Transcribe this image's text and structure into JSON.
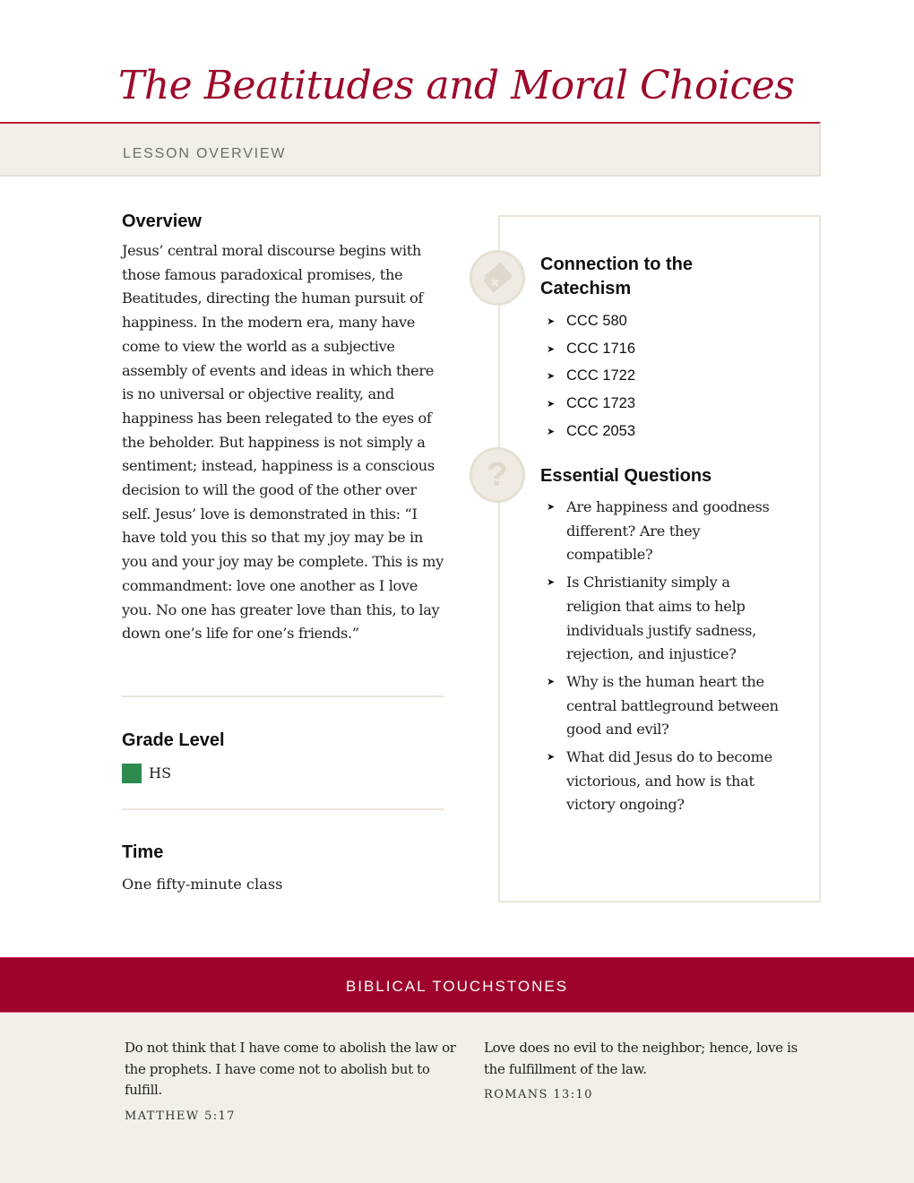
{
  "header": {
    "title": "The Beatitudes and Moral Choices",
    "band_label": "LESSON OVERVIEW"
  },
  "overview": {
    "heading": "Overview",
    "text": "Jesus’ central moral discourse begins with those famous paradoxical promises, the Beatitudes, directing the human pursuit of happiness. In the modern era, many have come to view the world as a subjective assembly of events and ideas in which there is no universal or objective reality, and happiness has been relegated to the eyes of the beholder. But happiness is not simply a sentiment; instead, happiness is a conscious decision to will the good of the other over self. Jesus’ love is demonstrated in this: “I have told you this so that my joy may be in you and your joy may be complete. This is my commandment: love one another as I love you. No one has greater love than this, to lay down one’s life for one’s friends.”"
  },
  "grade_level": {
    "heading": "Grade Level",
    "value": "HS",
    "swatch_color": "#2e8b4f"
  },
  "time": {
    "heading": "Time",
    "value": "One fifty-minute class"
  },
  "catechism": {
    "icon": "catechism-book-icon",
    "heading_line1": "Connection to the",
    "heading_line2": "Catechism",
    "items": [
      "CCC 580",
      "CCC 1716",
      "CCC 1722",
      "CCC 1723",
      "CCC 2053"
    ]
  },
  "essential_questions": {
    "icon": "question-mark-icon",
    "heading": "Essential Questions",
    "items": [
      "Are happiness and goodness different? Are they compatible?",
      "Is Christianity simply a religion that aims to help individuals justify sadness, rejection, and injustice?",
      "Why is the human heart the central battleground between good and evil?",
      "What did Jesus do to become victorious, and how is that victory ongoing?"
    ]
  },
  "touchstones": {
    "band_label": "BIBLICAL TOUCHSTONES",
    "quotes": [
      {
        "text": "Do not think that I have come to abolish the law or the prophets. I have come not to abolish but to fulfill.",
        "reference": "MATTHEW 5:17"
      },
      {
        "text": "Love does no evil to the neighbor; hence, love is the fulfillment of the law.",
        "reference": "ROMANS 13:10"
      }
    ]
  },
  "colors": {
    "accent": "#9d0a2b",
    "cream": "#f2efe8"
  }
}
